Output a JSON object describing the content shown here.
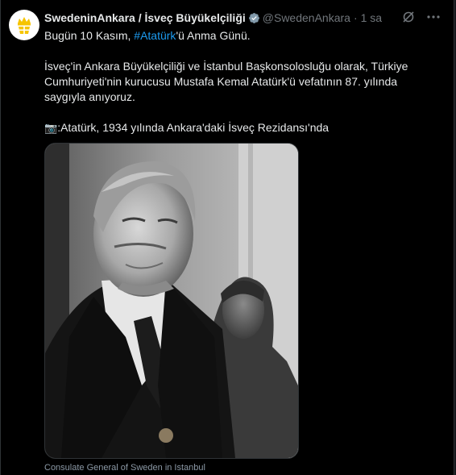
{
  "post": {
    "display_name": "SwedeninAnkara / İsveç Büyükelçiliği",
    "handle": "@SwedenAnkara",
    "dot": "·",
    "time": "1 sa",
    "line1_pre": "Bugün 10 Kasım, ",
    "hashtag": "#Atatürk",
    "line1_post": "'ü Anma Günü.",
    "para2_line1": "İsveç'in Ankara Büyükelçiliği ve İstanbul Başkonsolosluğu olarak, Türkiye",
    "para2_line2": "Cumhuriyeti'nin kurucusu Mustafa Kemal Atatürk'ü vefatının 87. yılında",
    "para2_line3": "saygıyla anıyoruz.",
    "camera_emoji": "📷",
    "photo_text": ":Atatürk, 1934 yılında Ankara'daki İsveç Rezidansı'nda",
    "media_caption": "Consulate General of Sweden in Istanbul"
  },
  "icons": {
    "avatar": "swedish-crown-emblem",
    "verified": "gray-verified-badge-icon",
    "grok": "grok-icon",
    "more": "more-icon"
  },
  "colors": {
    "background": "#000000",
    "text": "#e7e9ea",
    "secondary": "#71767b",
    "link": "#1d9bf0",
    "emblem_gold": "#f6c400"
  }
}
